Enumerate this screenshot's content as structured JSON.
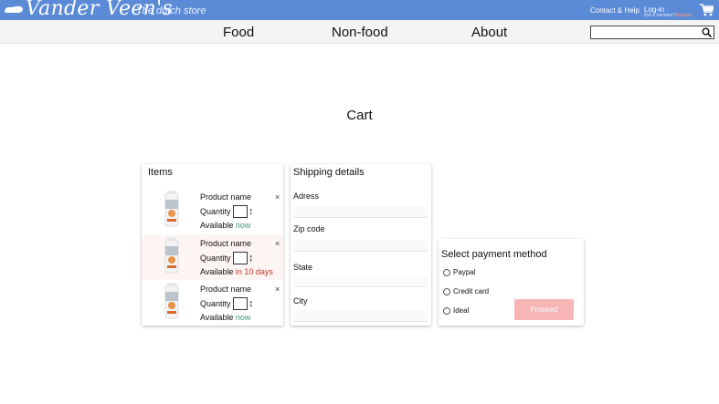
{
  "header": {
    "brand": "Vander Veen's",
    "tagline": "The dutch store",
    "contact_label": "Contact & Help",
    "login_label": "Log-in",
    "not_member_text": "Not a member?",
    "register_label": "Register",
    "brand_color": "#5b8ad6"
  },
  "nav": {
    "items": [
      "Food",
      "Non-food",
      "About"
    ],
    "search_placeholder": ""
  },
  "page": {
    "title": "Cart"
  },
  "items_card": {
    "title": "Items",
    "quantity_label": "Quantity",
    "available_label": "Available",
    "remove_symbol": "×",
    "items": [
      {
        "name": "Product name",
        "availability": "now"
      },
      {
        "name": "Product name",
        "availability": "in 10 days"
      },
      {
        "name": "Product name",
        "availability": "now"
      }
    ]
  },
  "shipping": {
    "title": "Shipping details",
    "fields": [
      "Adress",
      "Zip code",
      "State",
      "City"
    ]
  },
  "payment": {
    "title": "Select payment method",
    "options": [
      "Paypal",
      "Credit card",
      "Ideal"
    ],
    "proceed_label": "Proceed"
  },
  "icons": {
    "logo": "clog-icon",
    "cart": "shopping-cart-icon",
    "search": "search-icon",
    "quantity": "up-down-arrows-icon"
  }
}
